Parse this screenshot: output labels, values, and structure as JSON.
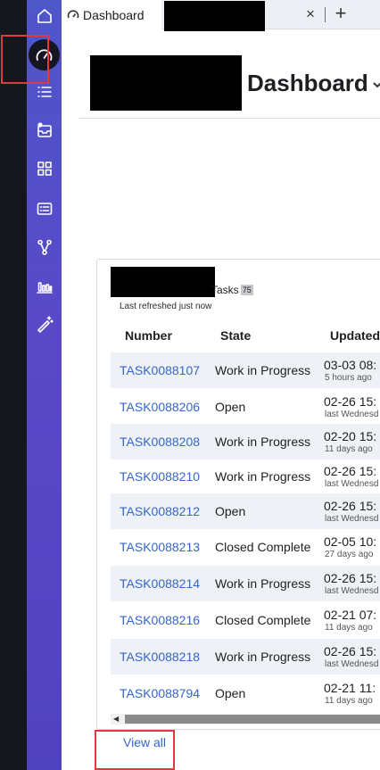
{
  "tabs": {
    "active_label": "Dashboard",
    "close_glyph": "×",
    "add_glyph": "+"
  },
  "header": {
    "title": "Dashboard"
  },
  "card": {
    "title": "Tasks",
    "count": "75",
    "refreshed": "Last refreshed just now",
    "columns": {
      "number": "Number",
      "state": "State",
      "updated": "Updated"
    },
    "rows": [
      {
        "number": "TASK0088107",
        "state": "Work in Progress",
        "updated": "03-03 08:",
        "relative": "5 hours ago"
      },
      {
        "number": "TASK0088206",
        "state": "Open",
        "updated": "02-26 15:",
        "relative": "last Wednesd"
      },
      {
        "number": "TASK0088208",
        "state": "Work in Progress",
        "updated": "02-20 15:",
        "relative": "11 days ago"
      },
      {
        "number": "TASK0088210",
        "state": "Work in Progress",
        "updated": "02-26 15:",
        "relative": "last Wednesd"
      },
      {
        "number": "TASK0088212",
        "state": "Open",
        "updated": "02-26 15:",
        "relative": "last Wednesd"
      },
      {
        "number": "TASK0088213",
        "state": "Closed Complete",
        "updated": "02-05 10:",
        "relative": "27 days ago"
      },
      {
        "number": "TASK0088214",
        "state": "Work in Progress",
        "updated": "02-26 15:",
        "relative": "last Wednesd"
      },
      {
        "number": "TASK0088216",
        "state": "Closed Complete",
        "updated": "02-21 07:",
        "relative": "11 days ago"
      },
      {
        "number": "TASK0088218",
        "state": "Work in Progress",
        "updated": "02-26 15:",
        "relative": "last Wednesd"
      },
      {
        "number": "TASK0088794",
        "state": "Open",
        "updated": "02-21 11:",
        "relative": "11 days ago"
      }
    ],
    "view_all": "View all"
  },
  "colors": {
    "sidebar": "#5a48c7",
    "link": "#3366cc",
    "annotation": "#e03a3e"
  },
  "icons": {
    "sidebar": [
      "home-icon",
      "dashboard-gauge-icon",
      "list-icon",
      "inbox-icon",
      "grid-icon",
      "form-icon",
      "workflow-icon",
      "bar-chart-icon",
      "magic-wand-icon"
    ]
  }
}
